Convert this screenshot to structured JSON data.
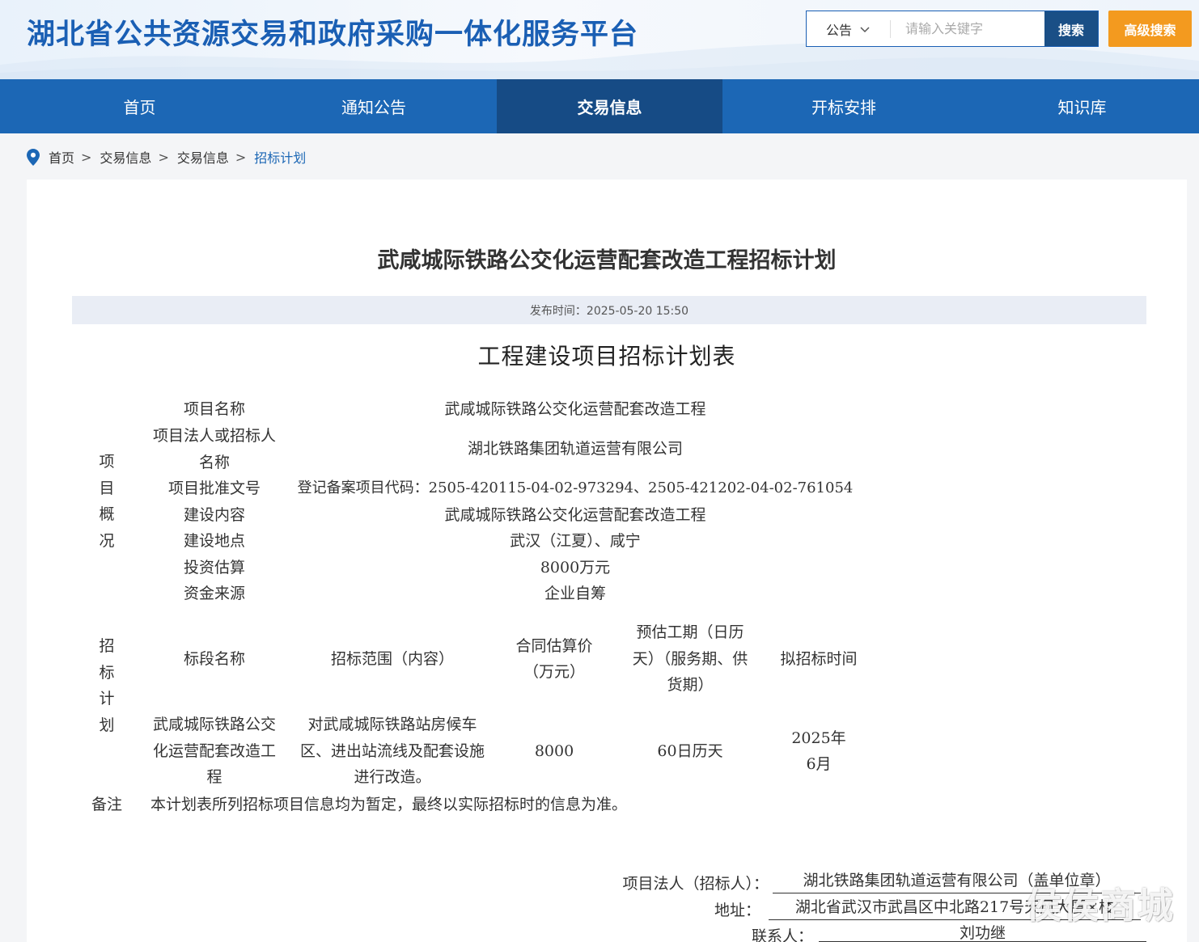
{
  "header": {
    "site_title": "湖北省公共资源交易和政府采购一体化服务平台",
    "search_type": "公告",
    "search_placeholder": "请输入关键字",
    "search_button": "搜索",
    "advanced_search": "高级搜索"
  },
  "nav": {
    "items": [
      {
        "label": "首页"
      },
      {
        "label": "通知公告"
      },
      {
        "label": "交易信息",
        "active": true
      },
      {
        "label": "开标安排"
      },
      {
        "label": "知识库"
      }
    ]
  },
  "breadcrumb": {
    "items": [
      "首页",
      "交易信息",
      "交易信息",
      "招标计划"
    ],
    "separator": ">"
  },
  "article": {
    "title": "武咸城际铁路公交化运营配套改造工程招标计划",
    "publish_time": "发布时间：2025-05-20 15:50",
    "doc_title": "工程建设项目招标计划表"
  },
  "overview": {
    "group_label": [
      "项",
      "目",
      "概",
      "况"
    ],
    "rows": [
      {
        "label": "项目名称",
        "value": "武咸城际铁路公交化运营配套改造工程"
      },
      {
        "label": "项目法人或招标人名称",
        "value": "湖北铁路集团轨道运营有限公司"
      },
      {
        "label": "项目批准文号",
        "value": "登记备案项目代码：2505-420115-04-02-973294、2505-421202-04-02-761054"
      },
      {
        "label": "建设内容",
        "value": "武咸城际铁路公交化运营配套改造工程"
      },
      {
        "label": "建设地点",
        "value": "武汉（江夏）、咸宁"
      },
      {
        "label": "投资估算",
        "value": "8000万元"
      },
      {
        "label": "资金来源",
        "value": "企业自筹"
      }
    ]
  },
  "bidding_plan": {
    "group_label": [
      "招",
      "标",
      "计",
      "划"
    ],
    "headers": [
      "标段名称",
      "招标范围（内容）",
      "合同估算价（万元）",
      "预估工期（日历天）（服务期、供货期）",
      "拟招标时间"
    ],
    "rows": [
      {
        "name": "武咸城际铁路公交化运营配套改造工程",
        "scope": "对武咸城际铁路站房候车区、进出站流线及配套设施进行改造。",
        "price": "8000",
        "period": "60日历天",
        "time": "2025年6月"
      }
    ]
  },
  "remarks": {
    "label": "备注",
    "text": "本计划表所列招标项目信息均为暂定，最终以实际招标时的信息为准。"
  },
  "signature": {
    "legal_person_label": "项目法人（招标人）：",
    "legal_person_value": "湖北铁路集团轨道运营有限公司（盖单位章）",
    "address_label": "地址：",
    "address_value": "湖北省武汉市武昌区中北路217号天风大厦×楼",
    "contact_label": "联系人：",
    "contact_value": "刘功继"
  },
  "watermark": "侯侯商城",
  "colors": {
    "brand_blue": "#1c67b5",
    "nav_active": "#164b85",
    "search_button": "#1a4f86",
    "advanced_button": "#f39a1f"
  }
}
